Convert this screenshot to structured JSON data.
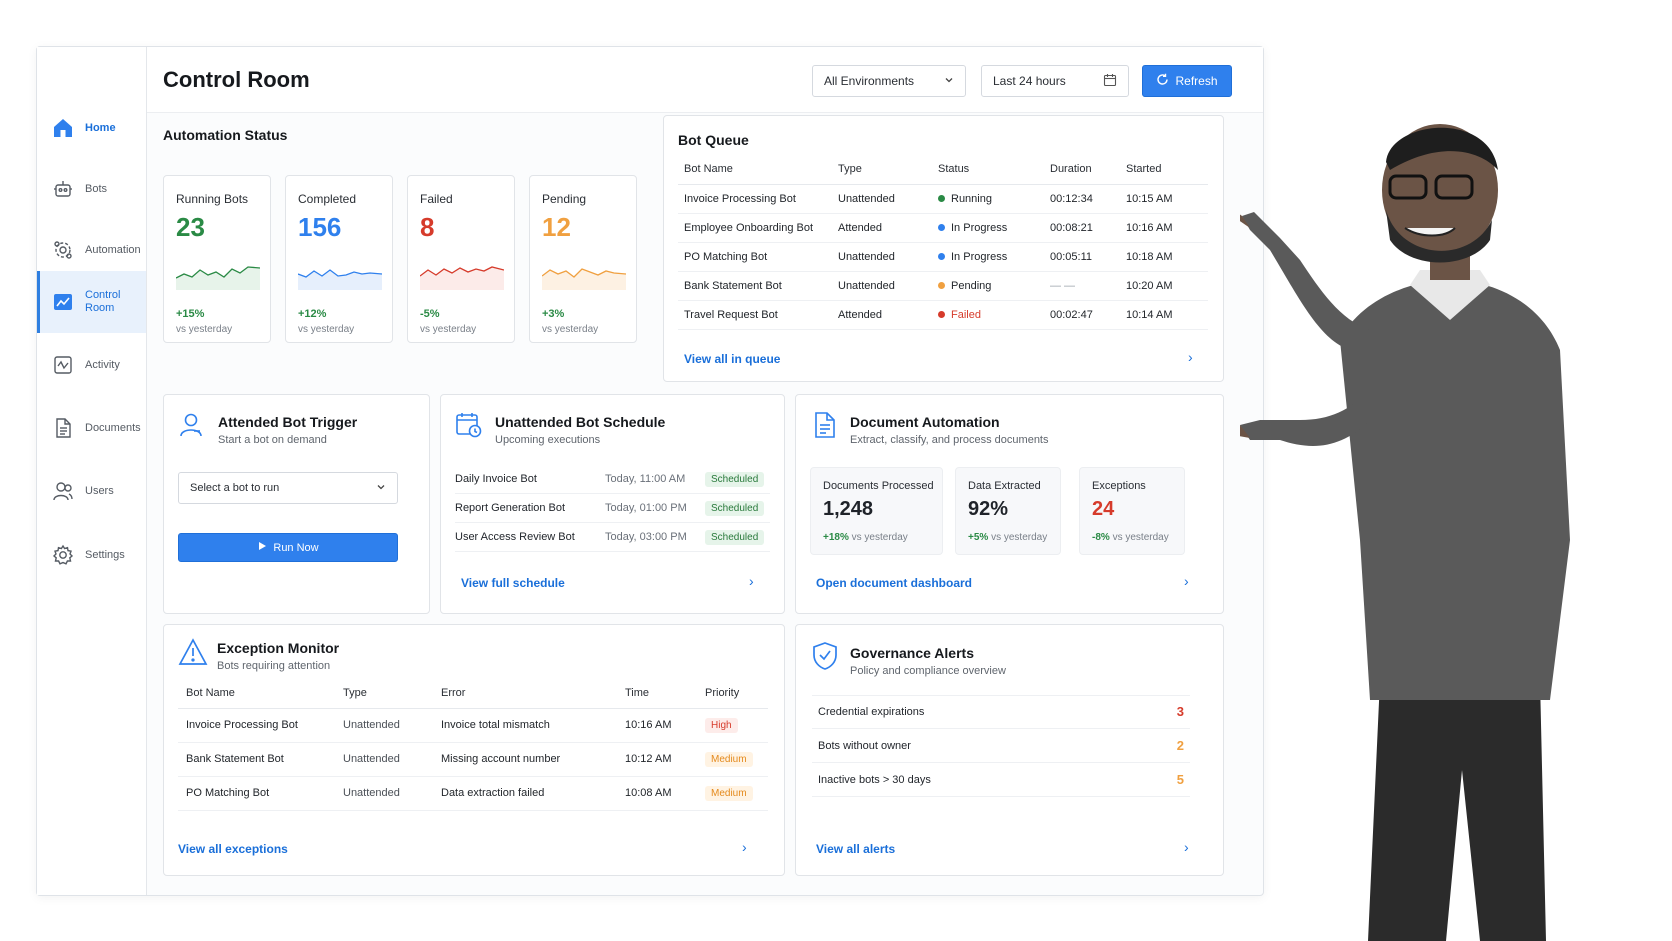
{
  "header": {
    "title": "Control Room",
    "environment": "All Environments",
    "time_range": "Last 24 hours",
    "refresh_label": "Refresh"
  },
  "sidebar": {
    "items": [
      {
        "label": "Home",
        "icon": "home-icon"
      },
      {
        "label": "Bots",
        "icon": "bots-icon"
      },
      {
        "label": "Automation",
        "icon": "automation-icon"
      },
      {
        "label": "Control Room",
        "icon": "chart-icon"
      },
      {
        "label": "Activity",
        "icon": "activity-icon"
      },
      {
        "label": "Documents",
        "icon": "document-icon"
      },
      {
        "label": "Users",
        "icon": "users-icon"
      },
      {
        "label": "Settings",
        "icon": "gear-icon"
      }
    ]
  },
  "automation_status": {
    "title": "Automation Status",
    "cards": [
      {
        "label": "Running Bots",
        "value": "23",
        "delta": "+15%",
        "sub": "vs yesterday",
        "color": "#2a8a45"
      },
      {
        "label": "Completed",
        "value": "156",
        "delta": "+12%",
        "sub": "vs yesterday",
        "color": "#2f80ed"
      },
      {
        "label": "Failed",
        "value": "8",
        "delta": "-5%",
        "sub": "vs yesterday",
        "color": "#d63b2b"
      },
      {
        "label": "Pending",
        "value": "12",
        "delta": "+3%",
        "sub": "vs yesterday",
        "color": "#f0a040"
      }
    ]
  },
  "bot_queue": {
    "title": "Bot Queue",
    "columns": [
      "Bot Name",
      "Type",
      "Status",
      "Duration",
      "Started"
    ],
    "rows": [
      {
        "name": "Invoice Processing Bot",
        "type": "Unattended",
        "status": "Running",
        "duration": "00:12:34",
        "started": "10:15 AM"
      },
      {
        "name": "Employee Onboarding Bot",
        "type": "Attended",
        "status": "In Progress",
        "duration": "00:08:21",
        "started": "10:16 AM"
      },
      {
        "name": "PO Matching Bot",
        "type": "Unattended",
        "status": "In Progress",
        "duration": "00:05:11",
        "started": "10:18 AM"
      },
      {
        "name": "Bank Statement Bot",
        "type": "Unattended",
        "status": "Pending",
        "duration": "— —",
        "started": "10:20 AM"
      },
      {
        "name": "Travel Request Bot",
        "type": "Attended",
        "status": "Failed",
        "duration": "00:02:47",
        "started": "10:14 AM"
      }
    ],
    "link": "View all in queue"
  },
  "attended": {
    "title": "Attended Bot Trigger",
    "subtitle": "Start a bot on demand",
    "select_placeholder": "Select a bot to run",
    "run_label": "Run Now"
  },
  "schedule": {
    "title": "Unattended Bot Schedule",
    "subtitle": "Upcoming executions",
    "rows": [
      {
        "name": "Daily Invoice Bot",
        "time": "Today, 11:00 AM",
        "status": "Scheduled"
      },
      {
        "name": "Report Generation Bot",
        "time": "Today, 01:00 PM",
        "status": "Scheduled"
      },
      {
        "name": "User Access Review Bot",
        "time": "Today, 03:00 PM",
        "status": "Scheduled"
      }
    ],
    "link": "View full schedule"
  },
  "documents": {
    "title": "Document Automation",
    "subtitle": "Extract, classify, and process documents",
    "metrics": [
      {
        "label": "Documents Processed",
        "value": "1,248",
        "delta": "+18%",
        "sub": "vs yesterday"
      },
      {
        "label": "Data Extracted",
        "value": "92%",
        "delta": "+5%",
        "sub": "vs yesterday"
      },
      {
        "label": "Exceptions",
        "value": "24",
        "delta": "-8%",
        "sub": "vs yesterday"
      }
    ],
    "link": "Open document dashboard"
  },
  "exceptions": {
    "title": "Exception Monitor",
    "subtitle": "Bots requiring attention",
    "columns": [
      "Bot Name",
      "Type",
      "Error",
      "Time",
      "Priority"
    ],
    "rows": [
      {
        "name": "Invoice Processing Bot",
        "type": "Unattended",
        "error": "Invoice total mismatch",
        "time": "10:16 AM",
        "priority": "High"
      },
      {
        "name": "Bank Statement Bot",
        "type": "Unattended",
        "error": "Missing account number",
        "time": "10:12 AM",
        "priority": "Medium"
      },
      {
        "name": "PO Matching Bot",
        "type": "Unattended",
        "error": "Data extraction failed",
        "time": "10:08 AM",
        "priority": "Medium"
      }
    ],
    "link": "View all exceptions"
  },
  "governance": {
    "title": "Governance Alerts",
    "subtitle": "Policy and compliance overview",
    "rows": [
      {
        "label": "Credential expirations",
        "value": "3",
        "color": "#d63b2b"
      },
      {
        "label": "Bots without owner",
        "value": "2",
        "color": "#f0a040"
      },
      {
        "label": "Inactive bots > 30 days",
        "value": "5",
        "color": "#f0a040"
      }
    ],
    "link": "View all alerts"
  }
}
